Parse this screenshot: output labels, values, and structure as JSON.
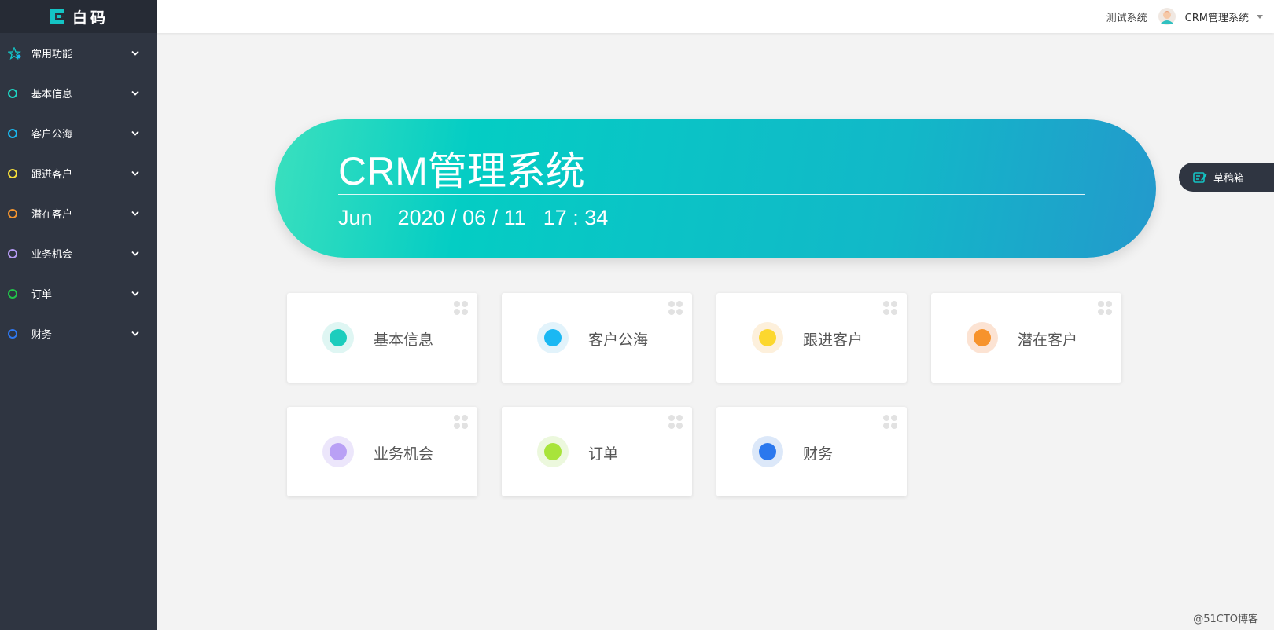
{
  "brand": {
    "logo_text": "白码",
    "accent": "#14c4c4"
  },
  "sidebar": {
    "items": [
      {
        "label": "常用功能",
        "icon": "star-icon",
        "color": "#14c4c4"
      },
      {
        "label": "基本信息",
        "icon": "circle-icon",
        "color": "#1ed7c5"
      },
      {
        "label": "客户公海",
        "icon": "circle-icon",
        "color": "#1ab9f0"
      },
      {
        "label": "跟进客户",
        "icon": "circle-icon",
        "color": "#f8e03a"
      },
      {
        "label": "潜在客户",
        "icon": "circle-icon",
        "color": "#f6962f"
      },
      {
        "label": "业务机会",
        "icon": "circle-icon",
        "color": "#b79cf5"
      },
      {
        "label": "订单",
        "icon": "circle-icon",
        "color": "#22c44a"
      },
      {
        "label": "财务",
        "icon": "circle-icon",
        "color": "#2f78f0"
      }
    ]
  },
  "topbar": {
    "system_link": "测试系统",
    "user_name": "CRM管理系统"
  },
  "banner": {
    "title": "CRM管理系统",
    "month": "Jun",
    "date": "2020 / 06 / 11",
    "time": "17 : 34"
  },
  "draft": {
    "label": "草稿箱"
  },
  "cards": [
    {
      "label": "基本信息",
      "color": "#1ccdbd",
      "bg": "#dff6f3"
    },
    {
      "label": "客户公海",
      "color": "#1ab8f3",
      "bg": "#e2f3fb"
    },
    {
      "label": "跟进客户",
      "color": "#fcd72e",
      "bg": "#fdf0dc"
    },
    {
      "label": "潜在客户",
      "color": "#f7932c",
      "bg": "#fce3d3"
    },
    {
      "label": "业务机会",
      "color": "#b9a0f5",
      "bg": "#ece6fb"
    },
    {
      "label": "订单",
      "color": "#a8e43a",
      "bg": "#ecf8dd"
    },
    {
      "label": "财务",
      "color": "#2b78ee",
      "bg": "#dce8f9"
    }
  ],
  "watermark": "@51CTO博客"
}
